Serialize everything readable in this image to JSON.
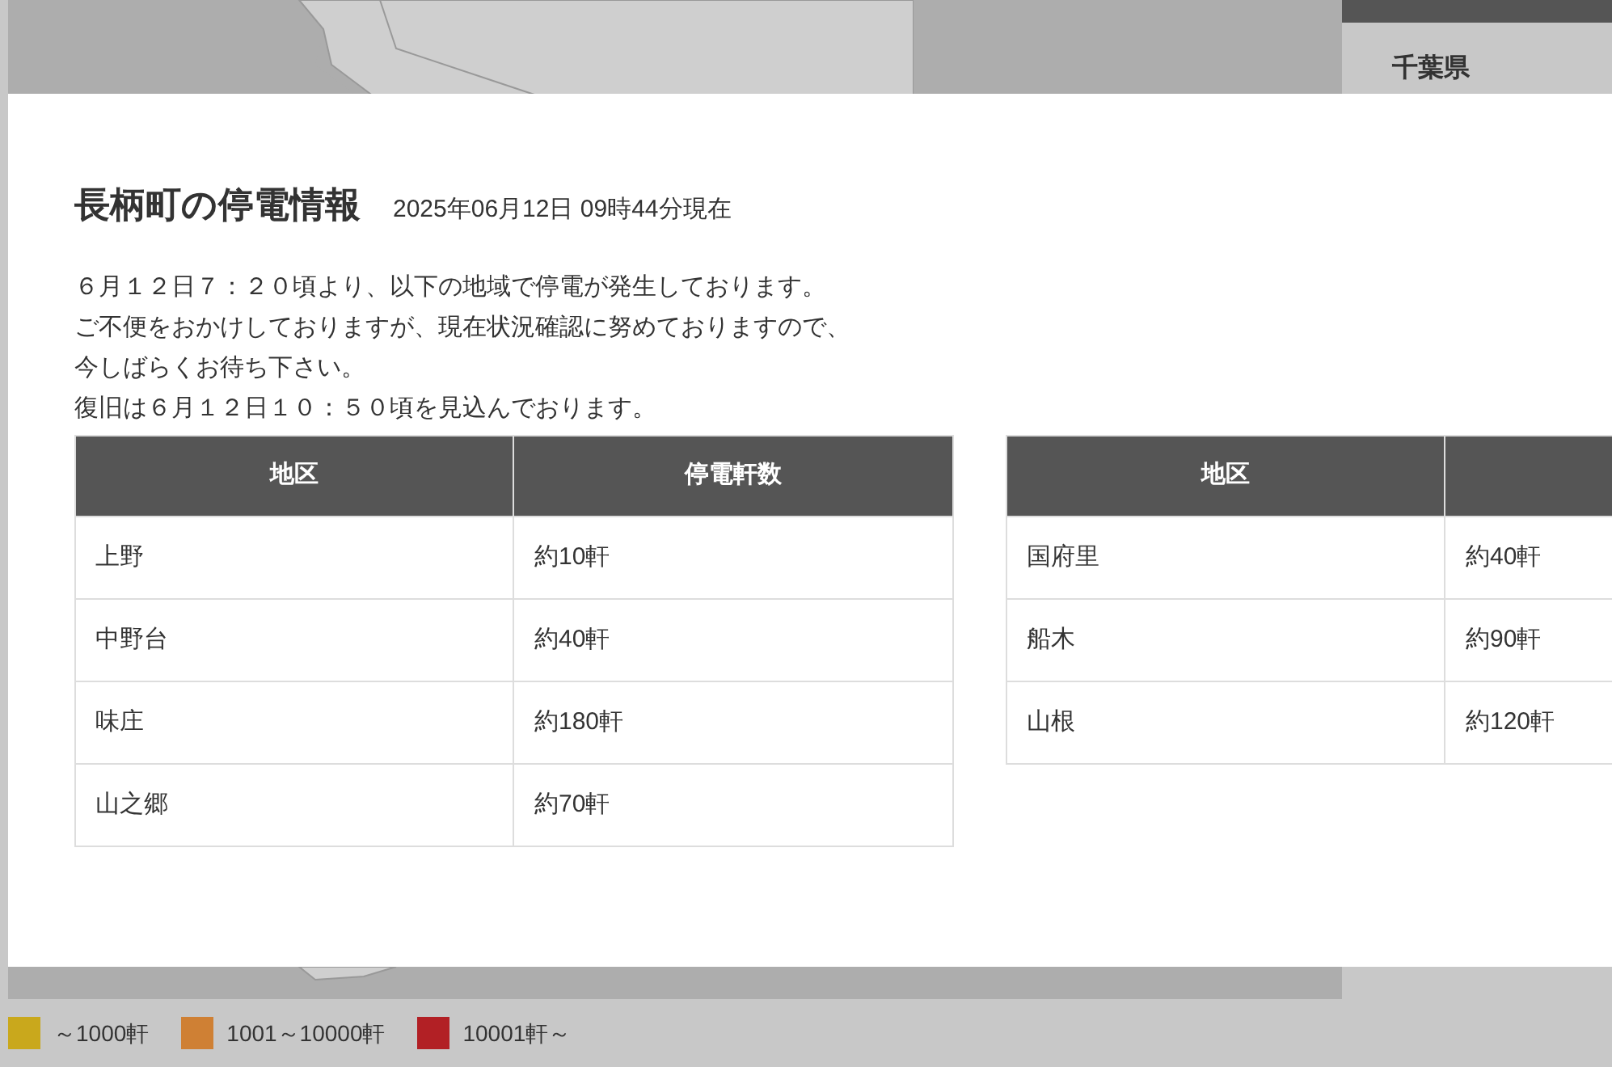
{
  "sidebar": {
    "title": "千葉県"
  },
  "dialog": {
    "title": "長柄町の停電情報",
    "timestamp": "2025年06月12日 09時44分現在",
    "message": [
      "６月１２日７：２０頃より、以下の地域で停電が発生しております。",
      "ご不便をおかけしておりますが、現在状況確認に努めておりますので、",
      "今しばらくお待ち下さい。",
      "復旧は６月１２日１０：５０頃を見込んでおります。"
    ],
    "tables": [
      {
        "columns": [
          "地区",
          "停電軒数"
        ],
        "rows": [
          [
            "上野",
            "約10軒"
          ],
          [
            "中野台",
            "約40軒"
          ],
          [
            "味庄",
            "約180軒"
          ],
          [
            "山之郷",
            "約70軒"
          ]
        ]
      },
      {
        "columns": [
          "地区"
        ],
        "rows": [
          [
            "国府里",
            "約40軒"
          ],
          [
            "船木",
            "約90軒"
          ],
          [
            "山根",
            "約120軒"
          ]
        ]
      }
    ]
  },
  "legend": [
    {
      "label": "～1000軒",
      "color": "#c9a81c"
    },
    {
      "label": "1001～10000軒",
      "color": "#cf8034"
    },
    {
      "label": "10001軒～",
      "color": "#b22025"
    }
  ]
}
